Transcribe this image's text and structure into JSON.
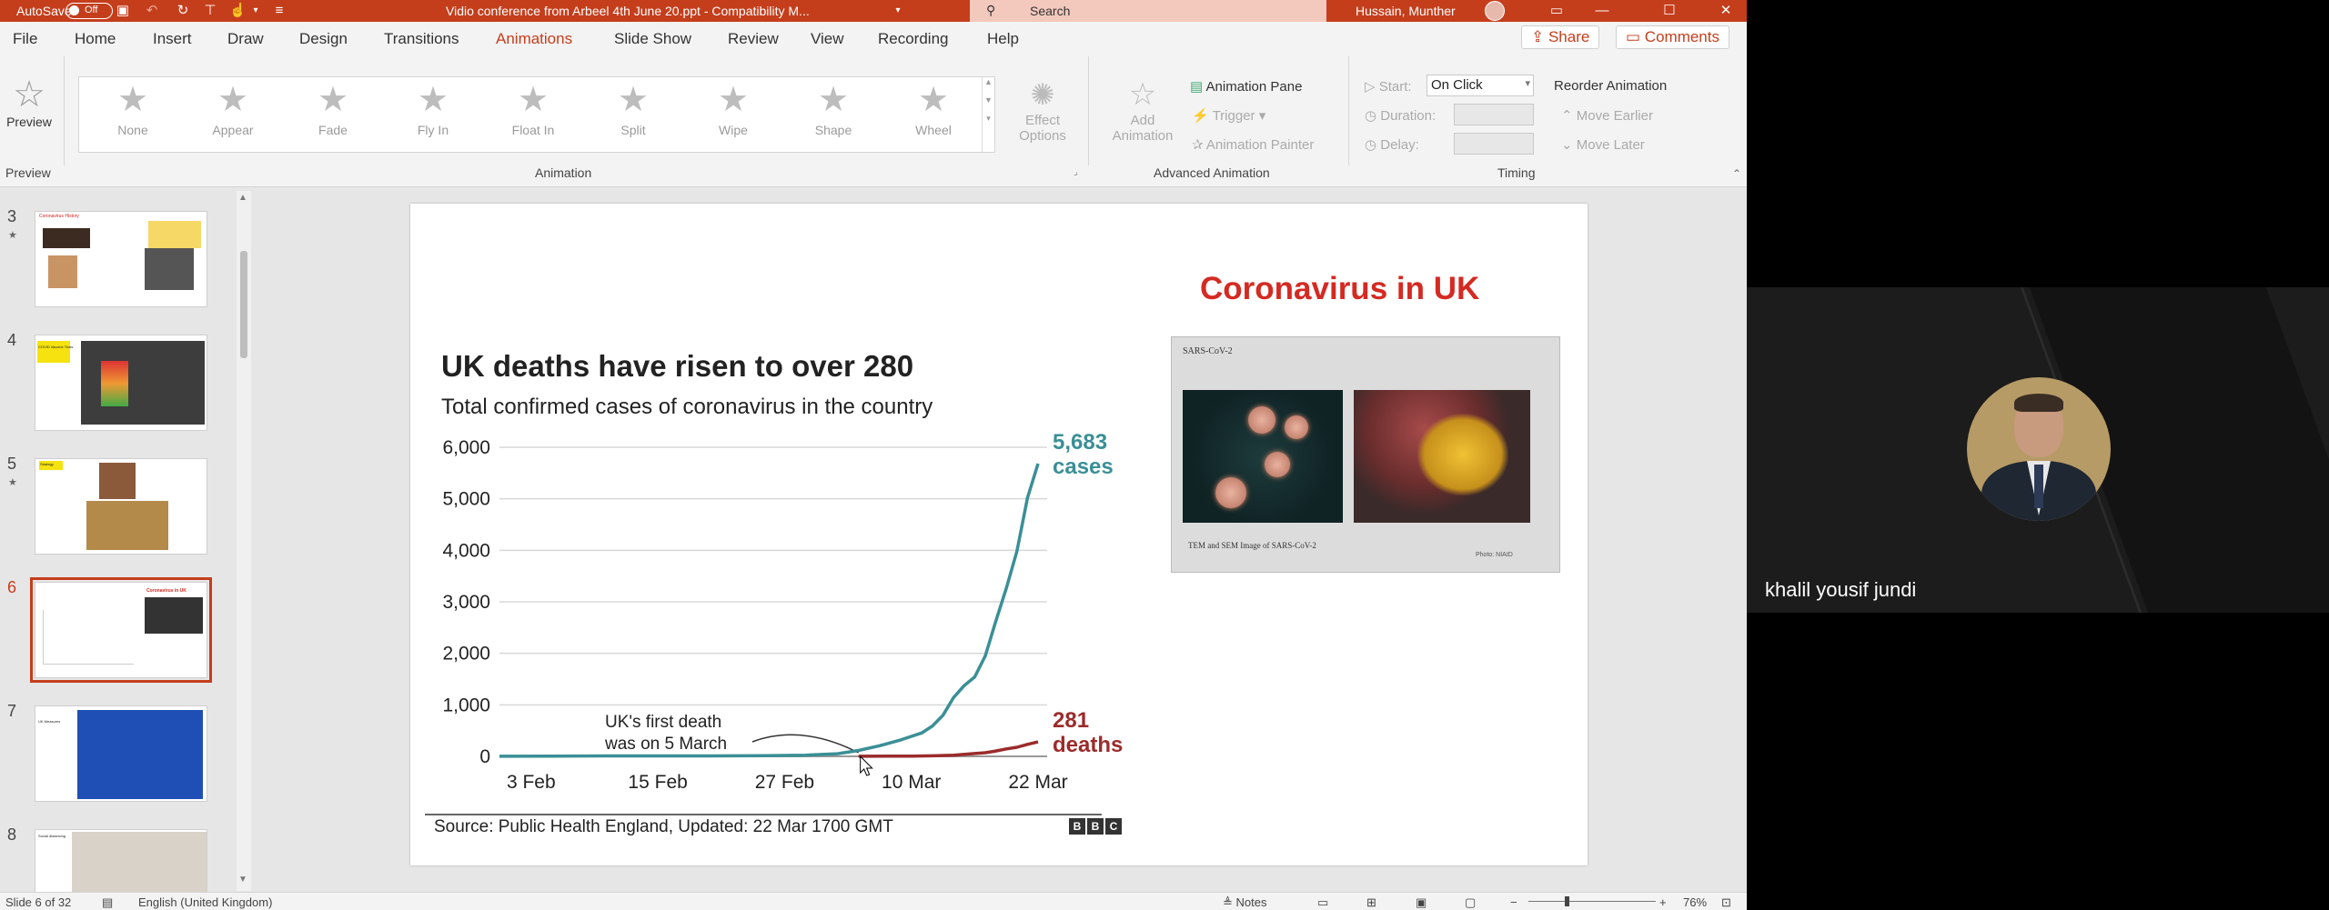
{
  "titlebar": {
    "autosave_label": "AutoSave",
    "autosave_state": "Off",
    "document_title": "Vidio conference from Arbeel 4th June 20.ppt  -  Compatibility M...",
    "search_placeholder": "Search",
    "user_name": "Hussain, Munther",
    "accent_color": "#c43e1c"
  },
  "menu": {
    "items": [
      "File",
      "Home",
      "Insert",
      "Draw",
      "Design",
      "Transitions",
      "Animations",
      "Slide Show",
      "Review",
      "View",
      "Recording",
      "Help"
    ],
    "active": "Animations",
    "share_label": "Share",
    "comments_label": "Comments"
  },
  "ribbon": {
    "preview_label": "Preview",
    "preview_group": "Preview",
    "animations": [
      "None",
      "Appear",
      "Fade",
      "Fly In",
      "Float In",
      "Split",
      "Wipe",
      "Shape",
      "Wheel"
    ],
    "effect_options_line1": "Effect",
    "effect_options_line2": "Options",
    "animation_group": "Animation",
    "add_animation_line1": "Add",
    "add_animation_line2": "Animation",
    "animation_pane": "Animation Pane",
    "trigger": "Trigger",
    "animation_painter": "Animation Painter",
    "advanced_group": "Advanced Animation",
    "start_label": "Start:",
    "start_value": "On Click",
    "duration_label": "Duration:",
    "delay_label": "Delay:",
    "timing_group": "Timing",
    "reorder_title": "Reorder Animation",
    "move_earlier": "Move Earlier",
    "move_later": "Move Later"
  },
  "thumbnails": [
    {
      "number": "3",
      "star": true,
      "heading": "Coronavirus History"
    },
    {
      "number": "4",
      "star": false,
      "heading": "COVID Vaccine Trials"
    },
    {
      "number": "5",
      "star": true,
      "heading": "Strategy"
    },
    {
      "number": "6",
      "star": false,
      "heading": "Coronavirus in UK",
      "active": true
    },
    {
      "number": "7",
      "star": false,
      "heading": "UK Measures"
    },
    {
      "number": "8",
      "star": false,
      "heading": "Social distancing"
    }
  ],
  "slide": {
    "heading": "Coronavirus in UK",
    "image_caption_top": "SARS-CoV-2",
    "image_caption_bottom": "TEM and SEM Image of SARS-CoV-2",
    "image_credit": "Photo: NIAID"
  },
  "chart_data": {
    "type": "line",
    "title": "UK deaths have risen to over 280",
    "subtitle": "Total confirmed cases of coronavirus in the country",
    "x_tick_labels": [
      "3 Feb",
      "15 Feb",
      "27 Feb",
      "10 Mar",
      "22 Mar"
    ],
    "x_range": [
      "31 Jan",
      "22 Mar"
    ],
    "y_ticks": [
      "6,000",
      "5,000",
      "4,000",
      "3,000",
      "2,000",
      "1,000",
      "0"
    ],
    "ylim": [
      0,
      6000
    ],
    "series": [
      {
        "name": "cases",
        "color": "#3a8f96",
        "end_label_value": "5,683",
        "end_label_unit": "cases",
        "points": [
          [
            "31 Jan",
            2
          ],
          [
            "5 Feb",
            3
          ],
          [
            "10 Feb",
            8
          ],
          [
            "15 Feb",
            9
          ],
          [
            "20 Feb",
            9
          ],
          [
            "25 Feb",
            13
          ],
          [
            "29 Feb",
            23
          ],
          [
            "3 Mar",
            51
          ],
          [
            "5 Mar",
            115
          ],
          [
            "7 Mar",
            206
          ],
          [
            "9 Mar",
            319
          ],
          [
            "11 Mar",
            456
          ],
          [
            "12 Mar",
            590
          ],
          [
            "13 Mar",
            798
          ],
          [
            "14 Mar",
            1140
          ],
          [
            "15 Mar",
            1372
          ],
          [
            "16 Mar",
            1543
          ],
          [
            "17 Mar",
            1950
          ],
          [
            "18 Mar",
            2626
          ],
          [
            "19 Mar",
            3269
          ],
          [
            "20 Mar",
            3983
          ],
          [
            "21 Mar",
            5018
          ],
          [
            "22 Mar",
            5683
          ]
        ]
      },
      {
        "name": "deaths",
        "color": "#9b2b2b",
        "end_label_value": "281",
        "end_label_unit": "deaths",
        "points": [
          [
            "5 Mar",
            1
          ],
          [
            "8 Mar",
            3
          ],
          [
            "10 Mar",
            6
          ],
          [
            "12 Mar",
            10
          ],
          [
            "14 Mar",
            21
          ],
          [
            "16 Mar",
            55
          ],
          [
            "17 Mar",
            71
          ],
          [
            "18 Mar",
            104
          ],
          [
            "19 Mar",
            144
          ],
          [
            "20 Mar",
            177
          ],
          [
            "21 Mar",
            233
          ],
          [
            "22 Mar",
            281
          ]
        ]
      }
    ],
    "annotation": "UK's first death was on 5 March",
    "source": "Source: Public Health England, Updated: 22 Mar 1700 GMT",
    "logo": "BBC",
    "grid": true
  },
  "statusbar": {
    "slide_info": "Slide 6 of 32",
    "language": "English (United Kingdom)",
    "notes": "Notes",
    "zoom": "76%"
  },
  "video": {
    "participant_name": "khalil yousif jundi"
  }
}
